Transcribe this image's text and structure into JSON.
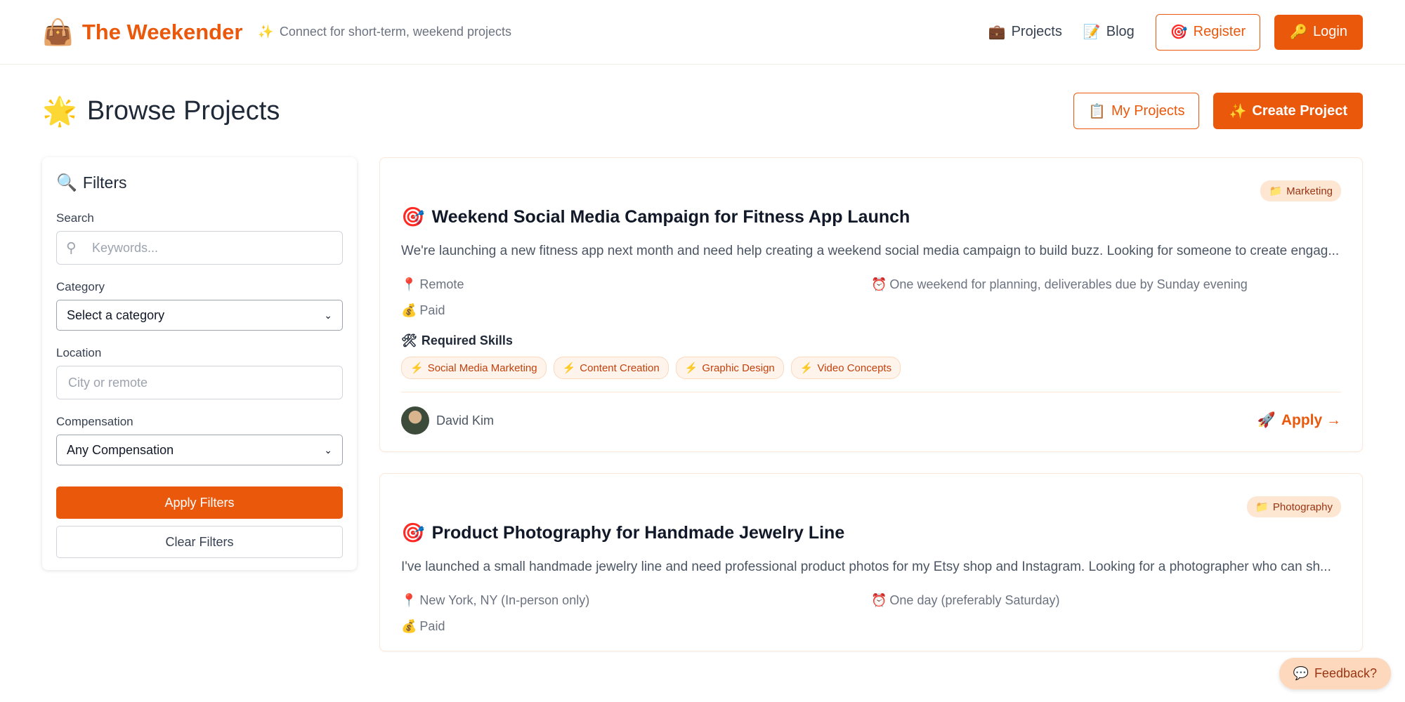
{
  "header": {
    "logo_icon": "👜",
    "brand": "The Weekender",
    "tagline_icon": "✨",
    "tagline": "Connect for short-term, weekend projects",
    "nav": [
      {
        "icon": "💼",
        "label": "Projects"
      },
      {
        "icon": "📝",
        "label": "Blog"
      }
    ],
    "register": {
      "icon": "🎯",
      "label": "Register"
    },
    "login": {
      "icon": "🔑",
      "label": "Login"
    }
  },
  "page": {
    "title_icon": "🌟",
    "title": "Browse Projects",
    "my_projects": {
      "icon": "📋",
      "label": "My Projects"
    },
    "create_project": {
      "icon": "✨",
      "label": "Create Project"
    }
  },
  "filters": {
    "title_icon": "🔍",
    "title": "Filters",
    "search": {
      "label": "Search",
      "placeholder": "Keywords..."
    },
    "category": {
      "label": "Category",
      "selected": "Select a category"
    },
    "location": {
      "label": "Location",
      "placeholder": "City or remote"
    },
    "compensation": {
      "label": "Compensation",
      "selected": "Any Compensation"
    },
    "apply_label": "Apply Filters",
    "clear_label": "Clear Filters"
  },
  "projects": [
    {
      "category_icon": "📁",
      "category": "Marketing",
      "title_icon": "🎯",
      "title": "Weekend Social Media Campaign for Fitness App Launch",
      "description": "We're launching a new fitness app next month and need help creating a weekend social media campaign to build buzz. Looking for someone to create engag...",
      "location_icon": "📍",
      "location": "Remote",
      "duration_icon": "⏰",
      "duration": "One weekend for planning, deliverables due by Sunday evening",
      "comp_icon": "💰",
      "compensation": "Paid",
      "skills_title_icon": "🛠",
      "skills_title": "Required Skills",
      "skill_icon": "⚡",
      "skills": [
        "Social Media Marketing",
        "Content Creation",
        "Graphic Design",
        "Video Concepts"
      ],
      "author": "David Kim",
      "apply_icon": "🚀",
      "apply_label": "Apply →"
    },
    {
      "category_icon": "📁",
      "category": "Photography",
      "title_icon": "🎯",
      "title": "Product Photography for Handmade Jewelry Line",
      "description": "I've launched a small handmade jewelry line and need professional product photos for my Etsy shop and Instagram. Looking for a photographer who can sh...",
      "location_icon": "📍",
      "location": "New York, NY (In-person only)",
      "duration_icon": "⏰",
      "duration": "One day (preferably Saturday)",
      "comp_icon": "💰",
      "compensation": "Paid"
    }
  ],
  "feedback": {
    "icon": "💬",
    "label": "Feedback?"
  },
  "colors": {
    "accent": "#ea580c",
    "badge_bg": "#fde6d2",
    "skill_bg": "#fff4ec"
  }
}
